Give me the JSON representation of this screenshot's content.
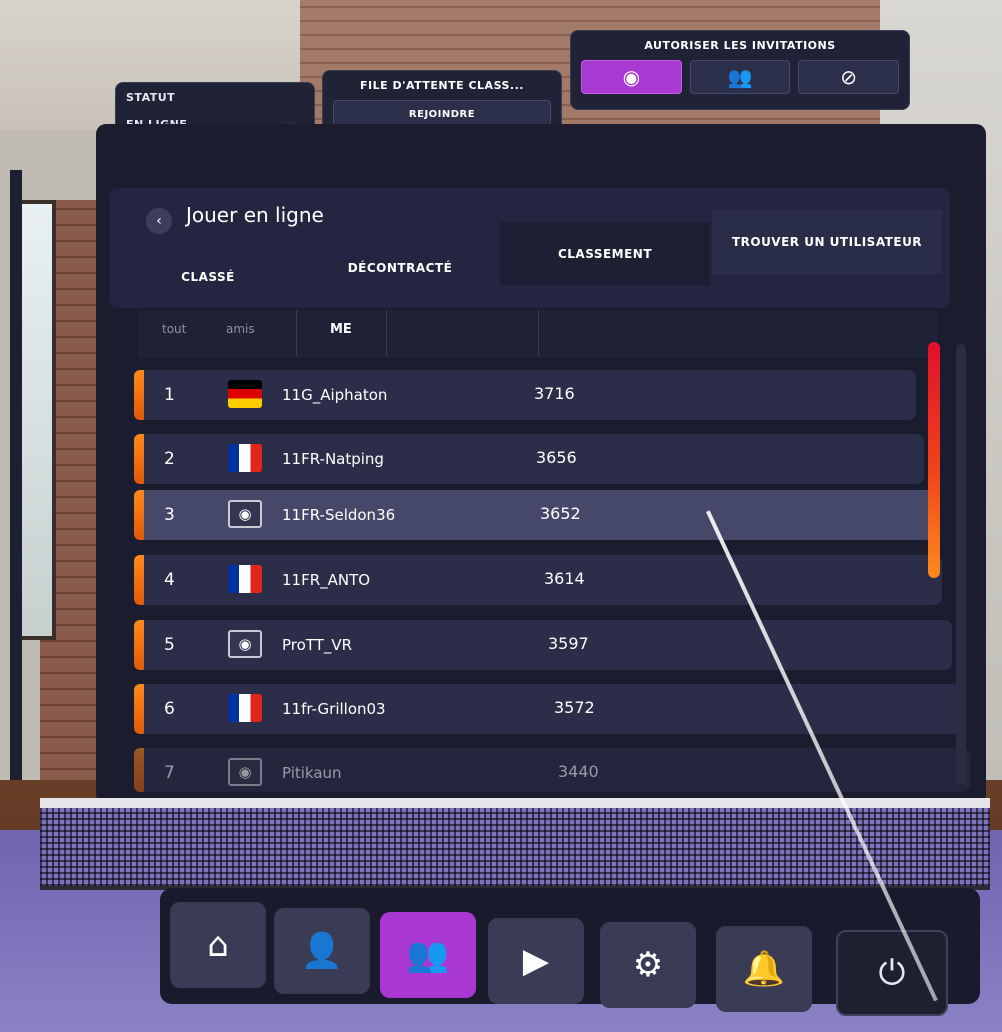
{
  "status": {
    "label": "STATUT",
    "value": "EN LIGNE"
  },
  "queue": {
    "label": "FILE D'ATTENTE CLASS...",
    "button": "REJOINDRE"
  },
  "invites": {
    "label": "AUTORISER LES INVITATIONS",
    "options": [
      {
        "icon": "globe-icon",
        "glyph": "◉",
        "active": true
      },
      {
        "icon": "friends-icon",
        "glyph": "👥",
        "active": false
      },
      {
        "icon": "block-icon",
        "glyph": "⊘",
        "active": false
      }
    ]
  },
  "page": {
    "title": "Jouer en ligne",
    "back_glyph": "‹"
  },
  "tabs": [
    {
      "label": "CLASSÉ"
    },
    {
      "label": "DÉCONTRACTÉ"
    },
    {
      "label": "CLASSEMENT",
      "selected": true
    },
    {
      "label": "TROUVER UN UTILISATEUR"
    }
  ],
  "subtabs": [
    {
      "label": "tout"
    },
    {
      "label": "amis"
    },
    {
      "label": "ME",
      "selected": true
    }
  ],
  "leaderboard": [
    {
      "rank": "1",
      "flag": "de",
      "name": "11G_Aiphaton",
      "score": "3716"
    },
    {
      "rank": "2",
      "flag": "fr",
      "name": "11FR-Natping",
      "score": "3656"
    },
    {
      "rank": "3",
      "flag": "globe",
      "name": "11FR-Seldon36",
      "score": "3652"
    },
    {
      "rank": "4",
      "flag": "fr",
      "name": "11FR_ANTO",
      "score": "3614"
    },
    {
      "rank": "5",
      "flag": "globe",
      "name": "ProTT_VR",
      "score": "3597"
    },
    {
      "rank": "6",
      "flag": "fr",
      "name": "11fr-Grillon03",
      "score": "3572"
    },
    {
      "rank": "7",
      "flag": "globe",
      "name": "Pitikaun",
      "score": "3440"
    }
  ],
  "nav": [
    {
      "icon": "home-icon",
      "glyph": "⌂"
    },
    {
      "icon": "profile-icon",
      "glyph": "👤"
    },
    {
      "icon": "social-icon",
      "glyph": "👥",
      "active": true
    },
    {
      "icon": "replay-icon",
      "glyph": "▶"
    },
    {
      "icon": "settings-icon",
      "glyph": "⚙"
    },
    {
      "icon": "notifications-icon",
      "glyph": "🔔"
    },
    {
      "icon": "power-icon",
      "glyph": "⏻"
    }
  ],
  "colors": {
    "accent": "#a93ad1",
    "online": "#3ce24a",
    "rank_stripe": "#ff8a1c"
  }
}
